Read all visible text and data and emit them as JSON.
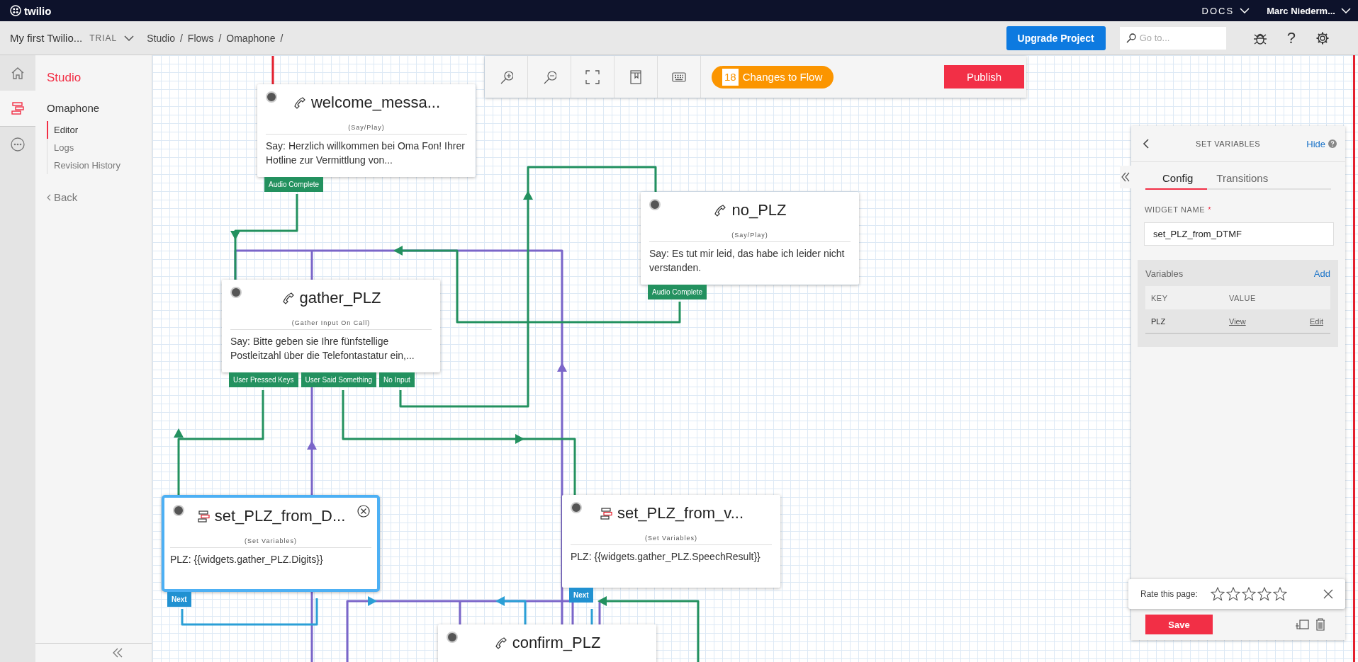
{
  "top_bar": {
    "logo": "twilio",
    "docs": "DOCS",
    "user": "Marc Niederm..."
  },
  "header": {
    "project": "My first Twilio...",
    "plan": "TRIAL",
    "separator": "/",
    "breadcrumbs": [
      "Studio",
      "Flows",
      "Omaphone"
    ],
    "upgrade_button": "Upgrade Project",
    "search": {
      "placeholder": "Go to..."
    },
    "help": "?"
  },
  "rail": {
    "items": [
      {
        "kind": "home",
        "selected": false
      },
      {
        "kind": "flow",
        "selected": true
      },
      {
        "kind": "more",
        "selected": false
      }
    ]
  },
  "sidebar": {
    "section": "Studio",
    "flow": "Omaphone",
    "items": [
      {
        "label": "Editor",
        "selected": true
      },
      {
        "label": "Logs",
        "selected": false
      },
      {
        "label": "Revision History",
        "selected": false
      }
    ],
    "back": "Back"
  },
  "toolbar": {
    "tools": [
      {
        "kind": "zoom-in"
      },
      {
        "kind": "zoom-out"
      },
      {
        "kind": "fit"
      },
      {
        "kind": "book"
      },
      {
        "kind": "keyboard"
      }
    ],
    "changes": {
      "count": "18",
      "label": "Changes to Flow"
    },
    "publish": "Publish"
  },
  "canvas": {
    "nodes": [
      {
        "kind": "say",
        "title": "welcome_messa...",
        "type": "(Say/Play)",
        "body": "Say: Herzlich willkommen bei Oma Fon! Ihrer Hotline zur Vermittlung von...",
        "transitions": [
          "Audio Complete"
        ],
        "selected": false
      },
      {
        "kind": "say",
        "title": "no_PLZ",
        "type": "(Say/Play)",
        "body": "Say: Es tut mir leid, das habe ich leider nicht verstanden.",
        "transitions": [
          "Audio Complete"
        ],
        "selected": false
      },
      {
        "kind": "gather",
        "title": "gather_PLZ",
        "type": "(Gather Input On Call)",
        "body": "Say: Bitte geben sie Ihre fünfstellige Postleitzahl über die Telefontastatur ein,...",
        "transitions": [
          "User Pressed Keys",
          "User Said Something",
          "No Input"
        ],
        "selected": false
      },
      {
        "kind": "set",
        "title": "set_PLZ_from_D...",
        "type": "(Set Variables)",
        "body": "PLZ: {{widgets.gather_PLZ.Digits}}",
        "transitions": [
          "Next"
        ],
        "selected": true
      },
      {
        "kind": "set",
        "title": "set_PLZ_from_v...",
        "type": "(Set Variables)",
        "body": "PLZ: {{widgets.gather_PLZ.SpeechResult}}",
        "transitions": [
          "Next"
        ],
        "selected": false
      },
      {
        "kind": "say",
        "title": "confirm_PLZ",
        "selected": false
      }
    ]
  },
  "panel": {
    "title": "SET VARIABLES",
    "hide": "Hide",
    "tabs": [
      {
        "label": "Config",
        "selected": true
      },
      {
        "label": "Transitions",
        "selected": false
      }
    ],
    "widget_name_label": "WIDGET NAME",
    "required_mark": "*",
    "widget_name": "set_PLZ_from_DTMF",
    "variables": {
      "title": "Variables",
      "add": "Add",
      "columns": [
        "KEY",
        "VALUE"
      ],
      "rows": [
        {
          "key": "PLZ",
          "view": "View",
          "edit": "Edit"
        }
      ]
    },
    "save": "Save"
  },
  "rating": {
    "label": "Rate this page:",
    "stars": 0
  }
}
